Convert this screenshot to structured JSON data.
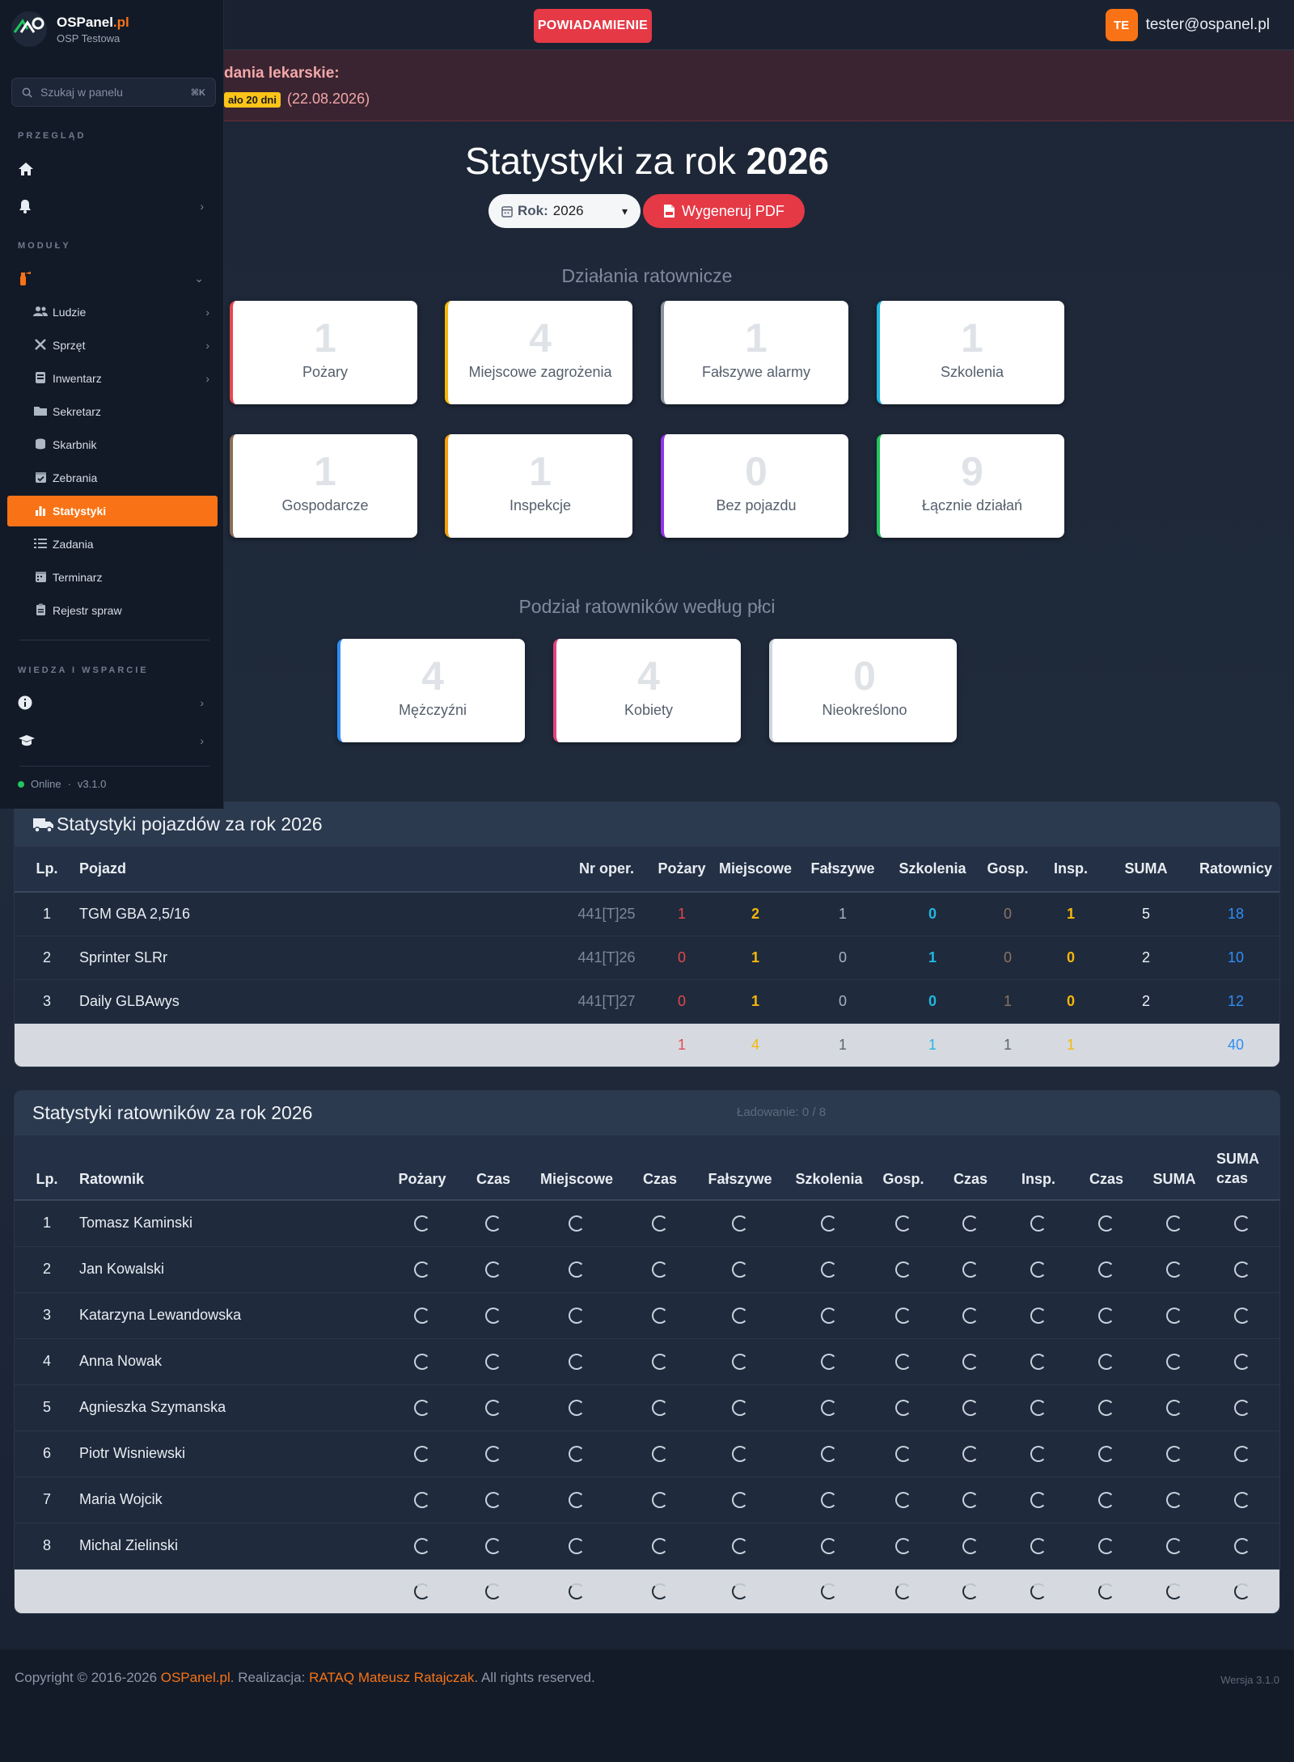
{
  "topbar": {
    "notification_label": "POWIADAMIENIE",
    "user_initials": "TE",
    "user_email": "tester@ospanel.pl"
  },
  "alert": {
    "title": "dania lekarskie:",
    "badge": "ało 20 dni",
    "date": "(22.08.2026)"
  },
  "sidebar": {
    "brand_main": "OSPanel",
    "brand_suffix": ".pl",
    "brand_sub": "OSP Testowa",
    "search_placeholder": "Szukaj w panelu",
    "search_shortcut": "⌘K",
    "section_overview": "PRZEGLĄD",
    "section_modules": "MODUŁY",
    "section_knowledge": "WIEDZA I WSPARCIE",
    "sub_items": [
      {
        "label": "Ludzie",
        "icon": "people-icon",
        "glyph": "👥",
        "chevron": true
      },
      {
        "label": "Sprzęt",
        "icon": "tools-icon",
        "glyph": "✕",
        "chevron": true
      },
      {
        "label": "Inwentarz",
        "icon": "inventory-icon",
        "glyph": "▤",
        "chevron": true
      },
      {
        "label": "Sekretarz",
        "icon": "folder-icon",
        "glyph": "▭",
        "chevron": false
      },
      {
        "label": "Skarbnik",
        "icon": "coins-icon",
        "glyph": "◎",
        "chevron": false
      },
      {
        "label": "Zebrania",
        "icon": "calendar-check-icon",
        "glyph": "▦",
        "chevron": false
      },
      {
        "label": "Statystyki",
        "icon": "chart-icon",
        "glyph": "▮",
        "chevron": false,
        "active": true
      },
      {
        "label": "Zadania",
        "icon": "tasks-icon",
        "glyph": "☰",
        "chevron": false
      },
      {
        "label": "Terminarz",
        "icon": "calendar-icon",
        "glyph": "▦",
        "chevron": false
      },
      {
        "label": "Rejestr spraw",
        "icon": "clipboard-icon",
        "glyph": "▤",
        "chevron": false
      }
    ],
    "status": "Online",
    "separator": "·",
    "version": "v3.1.0"
  },
  "main": {
    "title_prefix": "Statystyki za rok",
    "title_year": "2026",
    "year_label": "Rok:",
    "year_value": "2026",
    "pdf_label": "Wygeneruj PDF",
    "actions_header": "Działania ratownicze",
    "action_cards": [
      {
        "value": "1",
        "label": "Pożary",
        "color": "#e5484d"
      },
      {
        "value": "4",
        "label": "Miejscowe zagrożenia",
        "color": "#f5b70a"
      },
      {
        "value": "1",
        "label": "Fałszywe alarmy",
        "color": "#8a939f"
      },
      {
        "value": "1",
        "label": "Szkolenia",
        "color": "#20b8e0"
      },
      {
        "value": "1",
        "label": "Gospodarcze",
        "color": "#8b6d58"
      },
      {
        "value": "1",
        "label": "Inspekcje",
        "color": "#f59e0b"
      },
      {
        "value": "0",
        "label": "Bez pojazdu",
        "color": "#9333ea"
      },
      {
        "value": "9",
        "label": "Łącznie działań",
        "color": "#22c55e"
      }
    ],
    "gender_header": "Podział ratowników według płci",
    "gender_cards": [
      {
        "value": "4",
        "label": "Mężczyźni",
        "color": "#2f8ff5"
      },
      {
        "value": "4",
        "label": "Kobiety",
        "color": "#e0447c"
      },
      {
        "value": "0",
        "label": "Nieokreślono",
        "color": "#d0d6de"
      }
    ]
  },
  "vehicles": {
    "title": "Statystyki pojazdów za rok 2026",
    "columns": [
      "Lp.",
      "Pojazd",
      "Nr oper.",
      "Pożary",
      "Miejscowe",
      "Fałszywe",
      "Szkolenia",
      "Gosp.",
      "Insp.",
      "SUMA",
      "Ratownicy"
    ],
    "rows": [
      {
        "lp": "1",
        "name": "TGM GBA 2,5/16",
        "op": "441[T]25",
        "fire": "1",
        "local": "2",
        "false": "1",
        "train": "0",
        "gosp": "0",
        "insp": "1",
        "sum": "5",
        "resc": "18"
      },
      {
        "lp": "2",
        "name": "Sprinter SLRr",
        "op": "441[T]26",
        "fire": "0",
        "local": "1",
        "false": "0",
        "train": "1",
        "gosp": "0",
        "insp": "0",
        "sum": "2",
        "resc": "10"
      },
      {
        "lp": "3",
        "name": "Daily GLBAwys",
        "op": "441[T]27",
        "fire": "0",
        "local": "1",
        "false": "0",
        "train": "0",
        "gosp": "1",
        "insp": "0",
        "sum": "2",
        "resc": "12"
      }
    ],
    "totals": {
      "fire": "1",
      "local": "4",
      "false": "1",
      "train": "1",
      "gosp": "1",
      "insp": "1",
      "resc": "40"
    }
  },
  "rescuers": {
    "title": "Statystyki ratowników za rok 2026",
    "loading": "Ładowanie: 0 / 8",
    "columns": [
      "Lp.",
      "Ratownik",
      "Pożary",
      "Czas",
      "Miejscowe",
      "Czas",
      "Fałszywe",
      "Szkolenia",
      "Gosp.",
      "Czas",
      "Insp.",
      "Czas",
      "SUMA",
      "SUMA czas"
    ],
    "rows": [
      {
        "lp": "1",
        "name": "Tomasz Kaminski"
      },
      {
        "lp": "2",
        "name": "Jan Kowalski"
      },
      {
        "lp": "3",
        "name": "Katarzyna Lewandowska"
      },
      {
        "lp": "4",
        "name": "Anna Nowak"
      },
      {
        "lp": "5",
        "name": "Agnieszka Szymanska"
      },
      {
        "lp": "6",
        "name": "Piotr Wisniewski"
      },
      {
        "lp": "7",
        "name": "Maria Wojcik"
      },
      {
        "lp": "8",
        "name": "Michal Zielinski"
      }
    ]
  },
  "footer": {
    "prefix": "Copyright © 2016-2026 ",
    "brand": "OSPanel.pl",
    "mid": ". Realizacja: ",
    "author": "RATAQ Mateusz Ratajczak",
    "suffix": ". All rights reserved.",
    "version": "Wersja 3.1.0"
  }
}
